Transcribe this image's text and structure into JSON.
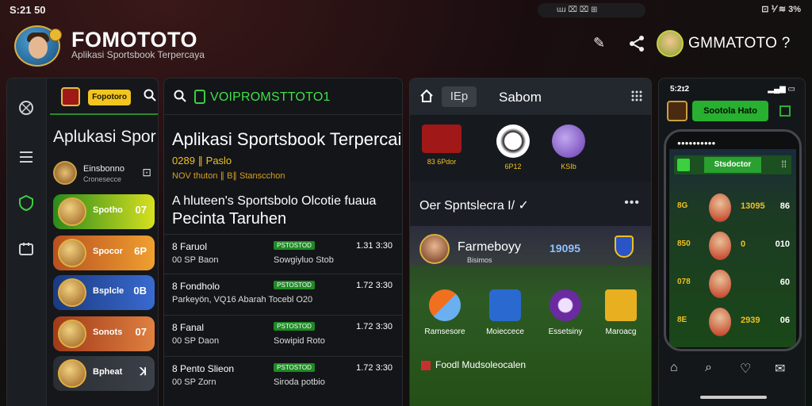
{
  "status": {
    "time": "S:21 50",
    "pill": "ɯɹ ⌧ ⌧ ⊞",
    "right": "⊡ ⅟ ≋ 3%"
  },
  "header": {
    "title": "FOMOTOTO",
    "subtitle": "Aplikasi Sportsbook Terpercaya",
    "user": "GMMATOTO ?",
    "edit_icon": "✎",
    "share_icon": "⋖"
  },
  "panel1": {
    "pill": "Fopotoro",
    "title": "Aplukasi Spor",
    "row": {
      "name": "Einsbonno",
      "sub": "Cronesecce",
      "icon": "⊡"
    },
    "cards": [
      {
        "label": "Spotho",
        "value": "07",
        "color1": "#2a8a1c",
        "color2": "#d8e020"
      },
      {
        "label": "Spocor",
        "value": "6P",
        "color1": "#b85020",
        "color2": "#f0a030"
      },
      {
        "label": "Bsplcle",
        "value": "0B",
        "color1": "#1a3a80",
        "color2": "#3a6ad0"
      },
      {
        "label": "Sonots",
        "value": "07",
        "color1": "#a03a18",
        "color2": "#e08040"
      },
      {
        "label": "Bpheat",
        "value": "ꓘ",
        "color1": "#2a2e34",
        "color2": "#3c4048"
      }
    ]
  },
  "panel2": {
    "header": "VOIPROMSTTOTO1",
    "title": "Aplikasi Sportsbook Terpercaia",
    "meta": "0289  ∥ Paslo",
    "meta2": "NOV thuton  ∥ B∥ Stanscchon",
    "sub1": "A hluteen's Sportsbolo Olcotie fuaua",
    "sub2": "Pecinta Taruhen",
    "matches": [
      {
        "name": "8  Faruol",
        "sub": "00 SP Baon",
        "pill": "PSTOSTOD",
        "team": "Sowgiyluo Stob",
        "time": "1.31 3:30"
      },
      {
        "name": "8  Fondholo",
        "sub": "Parkeyön, VQ16 Abarah Tocebl O20",
        "pill": "PSTOSTOD",
        "team": "",
        "time": "1.72 3:30"
      },
      {
        "name": "8  Fanal",
        "sub": "00 SP Daon",
        "pill": "PSTOSTOD",
        "team": "Sowipid Roto",
        "time": "1.72 3:30"
      },
      {
        "name": "8  Pento Slieon",
        "sub": "00 SP Zorn",
        "pill": "PSTOSTOD",
        "team": "Siroda potbio",
        "time": "1.72 3:30"
      }
    ]
  },
  "panel3": {
    "tab": "IEp",
    "title": "Sabom",
    "features": [
      {
        "label": "83 6Pdor"
      },
      {
        "label": "6P12"
      },
      {
        "label": "KSIb"
      }
    ],
    "section": "Oer Spntslecra I/ ✓",
    "user": "Farmeboyy",
    "user_sub": "Bisimos",
    "score": "19095",
    "games": [
      {
        "label": "Ramsesore",
        "color": "#e86020"
      },
      {
        "label": "Moieccece",
        "color": "#2a6ad0"
      },
      {
        "label": "Essetsiny",
        "color": "#6a2aa0"
      },
      {
        "label": "Maroacg",
        "color": "#e8b020"
      }
    ],
    "bottom": "Foodl Mudsoleocalen"
  },
  "panel4": {
    "time": "5:2ɪ2",
    "pill": "Sootola Hato",
    "tab": "Stsdoctor",
    "rows": [
      {
        "l": "8G",
        "v": "13095",
        "r": "86"
      },
      {
        "l": "850",
        "v": "0",
        "r": "010"
      },
      {
        "l": "078",
        "v": "",
        "r": "60"
      },
      {
        "l": "8E",
        "v": "2939",
        "r": "06"
      }
    ]
  }
}
